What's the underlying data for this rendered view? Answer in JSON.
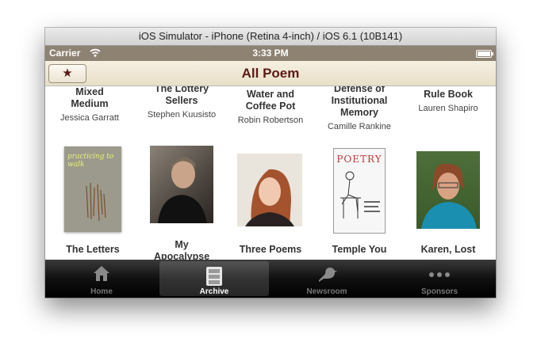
{
  "window": {
    "title": "iOS Simulator - iPhone (Retina 4-inch) / iOS 6.1 (10B141)"
  },
  "status": {
    "carrier": "Carrier",
    "time": "3:33 PM",
    "battery_level": 1.0
  },
  "navbar": {
    "title": "All Poem",
    "favorites_icon": "star-icon"
  },
  "poems_row1": [
    {
      "title": "Mixed Medium",
      "author": "Jessica Garratt"
    },
    {
      "title": "The Lottery Sellers",
      "author": "Stephen Kuusisto"
    },
    {
      "title": "Water and Coffee Pot",
      "author": "Robin Robertson"
    },
    {
      "title": "Defense of Institutional Memory",
      "author": "Camille Rankine"
    },
    {
      "title": "Rule Book",
      "author": "Lauren Shapiro"
    }
  ],
  "poems_row2": [
    {
      "title": "The Letters",
      "cover": "book-cover practicing to walk"
    },
    {
      "title": "My Apocalypse",
      "cover": "author-photo"
    },
    {
      "title": "Three Poems",
      "cover": "author-photo"
    },
    {
      "title": "Temple You",
      "cover": "poetry-magazine-cover"
    },
    {
      "title": "Karen, Lost",
      "cover": "author-photo"
    }
  ],
  "covers": {
    "book_text": "practicing to walk",
    "magazine_text": "POETRY"
  },
  "tabs": [
    {
      "label": "Home",
      "icon": "home-icon"
    },
    {
      "label": "Archive",
      "icon": "archive-icon",
      "selected": true
    },
    {
      "label": "Newsroom",
      "icon": "bird-icon"
    },
    {
      "label": "Sponsors",
      "icon": "more-dots-icon"
    }
  ],
  "colors": {
    "accent": "#5a1a16",
    "status_bar": "#8e8272",
    "nav_bg": "#f1ead8"
  }
}
